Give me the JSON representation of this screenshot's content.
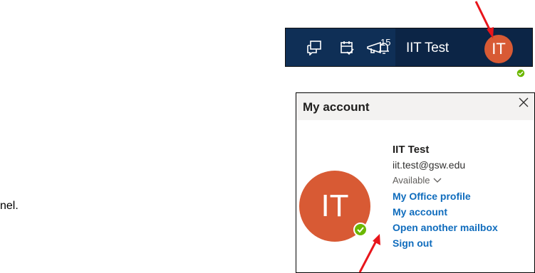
{
  "topbar": {
    "icons": [
      {
        "name": "chat-icon"
      },
      {
        "name": "todo-icon"
      },
      {
        "name": "bell-icon"
      },
      {
        "name": "gear-icon"
      },
      {
        "name": "help-icon"
      },
      {
        "name": "megaphone-icon"
      }
    ],
    "whats_new_count": "15",
    "user_name": "IIT Test",
    "avatar_initials": "IT",
    "colors": {
      "bar": "#0f2f56",
      "avatar": "#d85a34",
      "status": "#6bb700"
    }
  },
  "account_panel": {
    "title": "My account",
    "avatar_initials": "IT",
    "name": "IIT Test",
    "email": "iit.test@gsw.edu",
    "availability": "Available",
    "links": [
      "My Office profile",
      "My account",
      "Open another mailbox",
      "Sign out"
    ]
  },
  "side_text": "nel."
}
